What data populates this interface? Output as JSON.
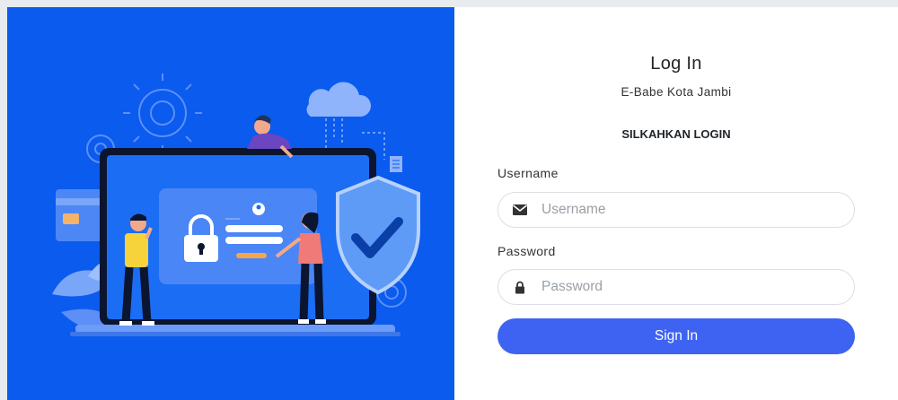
{
  "illustration": {
    "subject": "laptop-login-security-illustration"
  },
  "form": {
    "title": "Log In",
    "subtitle": "E-Babe Kota Jambi",
    "instruction": "SILKAHKAN LOGIN",
    "username": {
      "label": "Username",
      "placeholder": "Username",
      "value": "",
      "icon": "envelope-icon"
    },
    "password": {
      "label": "Password",
      "placeholder": "Password",
      "value": "",
      "icon": "lock-icon"
    },
    "submit_label": "Sign In"
  },
  "colors": {
    "illustration_bg": "#0a5bee",
    "button": "#3e63f2",
    "page_bg": "#e9ecef"
  }
}
